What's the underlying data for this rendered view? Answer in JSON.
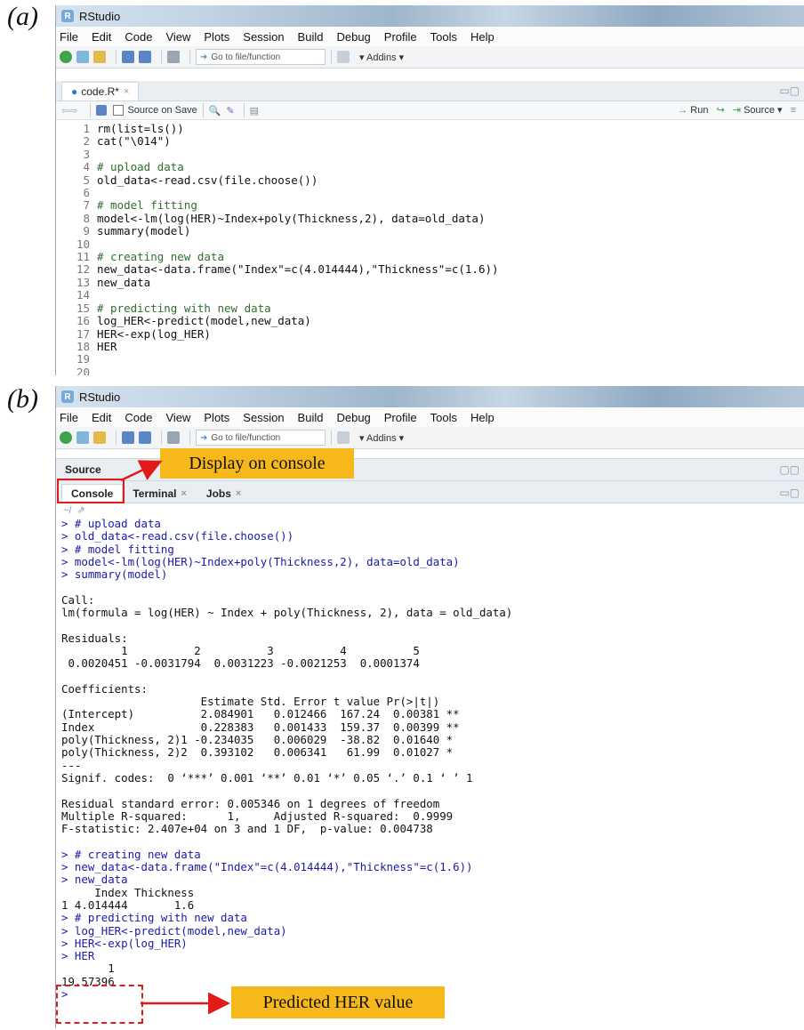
{
  "panels": {
    "a": {
      "label": "(a)"
    },
    "b": {
      "label": "(b)"
    }
  },
  "app": {
    "title": "RStudio",
    "menu": [
      "File",
      "Edit",
      "Code",
      "View",
      "Plots",
      "Session",
      "Build",
      "Debug",
      "Profile",
      "Tools",
      "Help"
    ],
    "goto_placeholder": "Go to file/function",
    "addins": "Addins"
  },
  "editor": {
    "tab_label": "code.R*",
    "source_on_save": "Source on Save",
    "run_label": "Run",
    "source_label": "Source",
    "lines": [
      {
        "n": "1",
        "text": "rm(list=ls())",
        "kind": "normal"
      },
      {
        "n": "2",
        "text": "cat(\"\\014\")",
        "kind": "normal"
      },
      {
        "n": "3",
        "text": "",
        "kind": "normal"
      },
      {
        "n": "4",
        "text": "# upload data",
        "kind": "comment"
      },
      {
        "n": "5",
        "text": "old_data<-read.csv(file.choose())",
        "kind": "normal"
      },
      {
        "n": "6",
        "text": "",
        "kind": "normal"
      },
      {
        "n": "7",
        "text": "# model fitting",
        "kind": "comment"
      },
      {
        "n": "8",
        "text": "model<-lm(log(HER)~Index+poly(Thickness,2), data=old_data)",
        "kind": "normal"
      },
      {
        "n": "9",
        "text": "summary(model)",
        "kind": "normal"
      },
      {
        "n": "10",
        "text": "",
        "kind": "normal"
      },
      {
        "n": "11",
        "text": "# creating new data",
        "kind": "comment"
      },
      {
        "n": "12",
        "text": "new_data<-data.frame(\"Index\"=c(4.014444),\"Thickness\"=c(1.6))",
        "kind": "normal"
      },
      {
        "n": "13",
        "text": "new_data",
        "kind": "normal"
      },
      {
        "n": "14",
        "text": "",
        "kind": "normal"
      },
      {
        "n": "15",
        "text": "# predicting with new data",
        "kind": "comment"
      },
      {
        "n": "16",
        "text": "log_HER<-predict(model,new_data)",
        "kind": "normal"
      },
      {
        "n": "17",
        "text": "HER<-exp(log_HER)",
        "kind": "normal"
      },
      {
        "n": "18",
        "text": "HER",
        "kind": "normal"
      },
      {
        "n": "19",
        "text": "",
        "kind": "normal"
      },
      {
        "n": "20",
        "text": "",
        "kind": "normal"
      }
    ]
  },
  "console_view": {
    "source_tab": "Source",
    "tabs": [
      {
        "label": "Console",
        "closable": false
      },
      {
        "label": "Terminal",
        "closable": true
      },
      {
        "label": "Jobs",
        "closable": true
      }
    ],
    "path": "~/",
    "lines": [
      {
        "text": "> # upload data",
        "kind": "cmd"
      },
      {
        "text": "> old_data<-read.csv(file.choose())",
        "kind": "cmd"
      },
      {
        "text": "> # model fitting",
        "kind": "cmd"
      },
      {
        "text": "> model<-lm(log(HER)~Index+poly(Thickness,2), data=old_data)",
        "kind": "cmd"
      },
      {
        "text": "> summary(model)",
        "kind": "cmd"
      },
      {
        "text": "",
        "kind": "out"
      },
      {
        "text": "Call:",
        "kind": "out"
      },
      {
        "text": "lm(formula = log(HER) ~ Index + poly(Thickness, 2), data = old_data)",
        "kind": "out"
      },
      {
        "text": "",
        "kind": "out"
      },
      {
        "text": "Residuals:",
        "kind": "out"
      },
      {
        "text": "         1          2          3          4          5 ",
        "kind": "out"
      },
      {
        "text": " 0.0020451 -0.0031794  0.0031223 -0.0021253  0.0001374 ",
        "kind": "out"
      },
      {
        "text": "",
        "kind": "out"
      },
      {
        "text": "Coefficients:",
        "kind": "out"
      },
      {
        "text": "                     Estimate Std. Error t value Pr(>|t|)   ",
        "kind": "out"
      },
      {
        "text": "(Intercept)          2.084901   0.012466  167.24  0.00381 **",
        "kind": "out"
      },
      {
        "text": "Index                0.228383   0.001433  159.37  0.00399 **",
        "kind": "out"
      },
      {
        "text": "poly(Thickness, 2)1 -0.234035   0.006029  -38.82  0.01640 * ",
        "kind": "out"
      },
      {
        "text": "poly(Thickness, 2)2  0.393102   0.006341   61.99  0.01027 * ",
        "kind": "out"
      },
      {
        "text": "---",
        "kind": "out"
      },
      {
        "text": "Signif. codes:  0 ‘***’ 0.001 ‘**’ 0.01 ‘*’ 0.05 ‘.’ 0.1 ‘ ’ 1",
        "kind": "out"
      },
      {
        "text": "",
        "kind": "out"
      },
      {
        "text": "Residual standard error: 0.005346 on 1 degrees of freedom",
        "kind": "out"
      },
      {
        "text": "Multiple R-squared:      1,\tAdjusted R-squared:  0.9999 ",
        "kind": "out"
      },
      {
        "text": "F-statistic: 2.407e+04 on 3 and 1 DF,  p-value: 0.004738",
        "kind": "out"
      },
      {
        "text": "",
        "kind": "out"
      },
      {
        "text": "> # creating new data",
        "kind": "cmd"
      },
      {
        "text": "> new_data<-data.frame(\"Index\"=c(4.014444),\"Thickness\"=c(1.6))",
        "kind": "cmd"
      },
      {
        "text": "> new_data",
        "kind": "cmd"
      },
      {
        "text": "     Index Thickness",
        "kind": "out"
      },
      {
        "text": "1 4.014444       1.6",
        "kind": "out"
      },
      {
        "text": "> # predicting with new data",
        "kind": "cmd"
      },
      {
        "text": "> log_HER<-predict(model,new_data)",
        "kind": "cmd"
      },
      {
        "text": "> HER<-exp(log_HER)",
        "kind": "cmd"
      },
      {
        "text": "> HER",
        "kind": "cmd"
      },
      {
        "text": "       1 ",
        "kind": "out"
      },
      {
        "text": "19.57396 ",
        "kind": "out"
      },
      {
        "text": "> ",
        "kind": "cmd"
      }
    ]
  },
  "annotations": {
    "display_on_console": "Display on console",
    "predicted_her": "Predicted HER value",
    "highlight_color": "#e11a1a",
    "callout_color": "#f6b81a"
  }
}
